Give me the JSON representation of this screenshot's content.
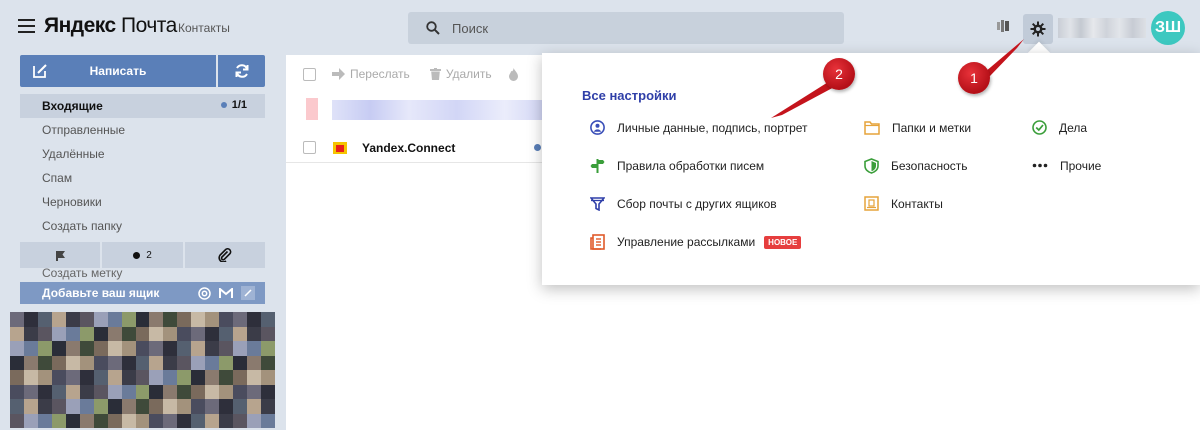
{
  "header": {
    "logo_brand": "Яндекс",
    "logo_product": "Почта",
    "contacts_link": "Контакты",
    "search_placeholder": "Поиск",
    "avatar_initials": "ЗШ"
  },
  "sidebar": {
    "compose_label": "Написать",
    "folders": [
      {
        "label": "Входящие",
        "count": "1/1"
      },
      {
        "label": "Отправленные"
      },
      {
        "label": "Удалённые"
      },
      {
        "label": "Спам"
      },
      {
        "label": "Черновики"
      },
      {
        "label": "Создать папку"
      }
    ],
    "filter_unread_count": "2",
    "create_label": "Создать метку",
    "add_mailbox_label": "Добавьте ваш ящик"
  },
  "toolbar": {
    "forward_label": "Переслать",
    "delete_label": "Удалить"
  },
  "messages": [
    {
      "sender": "Yandex.Connect"
    }
  ],
  "settings_popup": {
    "title": "Все настройки",
    "items": [
      {
        "label": "Личные данные, подпись, портрет",
        "icon": "person-circle-icon"
      },
      {
        "label": "Правила обработки писем",
        "icon": "signpost-icon"
      },
      {
        "label": "Сбор почты с других ящиков",
        "icon": "funnel-icon"
      },
      {
        "label": "Управление рассылками",
        "icon": "newsletter-icon",
        "badge": "НОВОЕ"
      },
      {
        "label": "Папки и метки",
        "icon": "folder-icon"
      },
      {
        "label": "Безопасность",
        "icon": "shield-icon"
      },
      {
        "label": "Контакты",
        "icon": "contacts-icon"
      },
      {
        "label": "Дела",
        "icon": "check-circle-icon"
      },
      {
        "label": "Прочие",
        "icon": "dots-icon"
      }
    ]
  },
  "callouts": [
    "1",
    "2"
  ],
  "colors": {
    "accent_blue": "#5a7fb8",
    "header_bg": "#dce3ec",
    "popup_title": "#2f3fa8",
    "callout_red": "#c4141c",
    "badge_red": "#e63e3e",
    "avatar": "#3dc8c0"
  }
}
